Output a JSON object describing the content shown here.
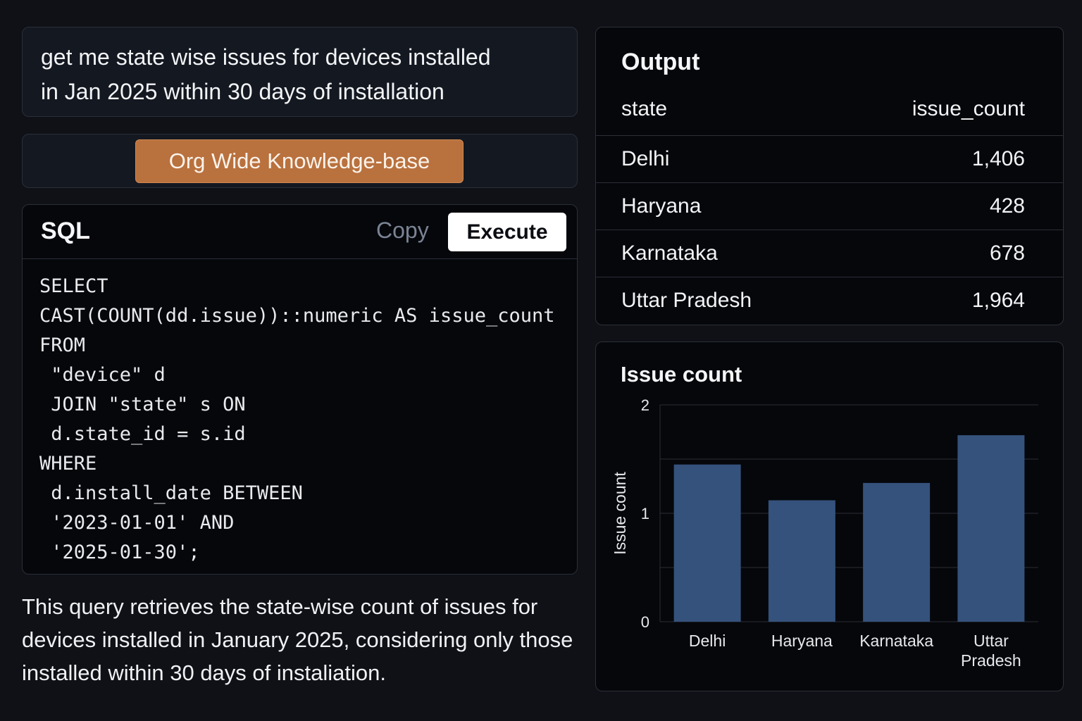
{
  "prompt": {
    "line1": "get me state wise issues for devices installed",
    "line2": "in Jan 2025 within 30 days of installation"
  },
  "knowledge_base": {
    "button_label": "Org Wide Knowledge-base"
  },
  "sql": {
    "title": "SQL",
    "copy_label": "Copy",
    "execute_label": "Execute",
    "code": "SELECT\nCAST(COUNT(dd.issue))::numeric AS issue_count\nFROM\n \"device\" d\n JOIN \"state\" s ON\n d.state_id = s.id\nWHERE\n d.install_date BETWEEN\n '2023-01-01' AND\n '2025-01-30';"
  },
  "explanation": "This query retrieves the state-wise count of issues for devices installed in January 2025, considering only those installed within 30 days of instaliation.",
  "output": {
    "title": "Output",
    "columns": [
      "state",
      "issue_count"
    ],
    "rows": [
      {
        "state": "Delhi",
        "issue_count": "1,406"
      },
      {
        "state": "Haryana",
        "issue_count": "428"
      },
      {
        "state": "Karnataka",
        "issue_count": "678"
      },
      {
        "state": "Uttar Pradesh",
        "issue_count": "1,964"
      }
    ]
  },
  "colors": {
    "background": "#0f1117",
    "accent_button": "#b9713e",
    "bar": "#35527c"
  },
  "chart_data": {
    "type": "bar",
    "title": "Issue count",
    "xlabel": "",
    "ylabel": "Issue count",
    "categories": [
      "Delhi",
      "Haryana",
      "Karnataka",
      "Uttar Pradesh"
    ],
    "category_labels": [
      [
        "Delhi"
      ],
      [
        "Haryana"
      ],
      [
        "Karnataka"
      ],
      [
        "Uttar",
        "Pradesh"
      ]
    ],
    "values": [
      1.45,
      1.12,
      1.28,
      1.72
    ],
    "ylim": [
      0,
      2
    ],
    "yticks": [
      0,
      1,
      2
    ],
    "grid": true
  }
}
